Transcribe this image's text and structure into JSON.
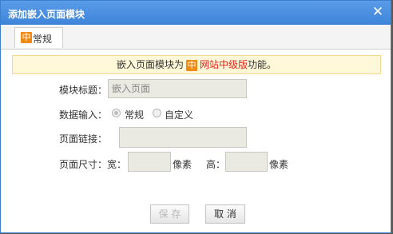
{
  "window": {
    "title": "添加嵌入页面模块"
  },
  "tab": {
    "badge": "中",
    "label": "常规"
  },
  "notice": {
    "prefix": "嵌入页面模块为",
    "badge": "中",
    "highlight": "网站中级版",
    "suffix": "功能。"
  },
  "form": {
    "title_label": "模块标题：",
    "title_value": "嵌入页面",
    "data_input_label": "数据输入：",
    "radio_normal": "常规",
    "radio_custom": "自定义",
    "link_label": "页面链接：",
    "link_value": "",
    "size_label": "页面尺寸：宽：",
    "width_value": "",
    "width_unit": "像素",
    "height_label": "高：",
    "height_value": "",
    "height_unit": "像素"
  },
  "buttons": {
    "save": "保 存",
    "cancel": "取 消"
  },
  "colors": {
    "titlebar": "#4a90e0",
    "badge": "#f08a12",
    "highlight": "#e0231a",
    "notice_bg": "#fff8d8"
  }
}
